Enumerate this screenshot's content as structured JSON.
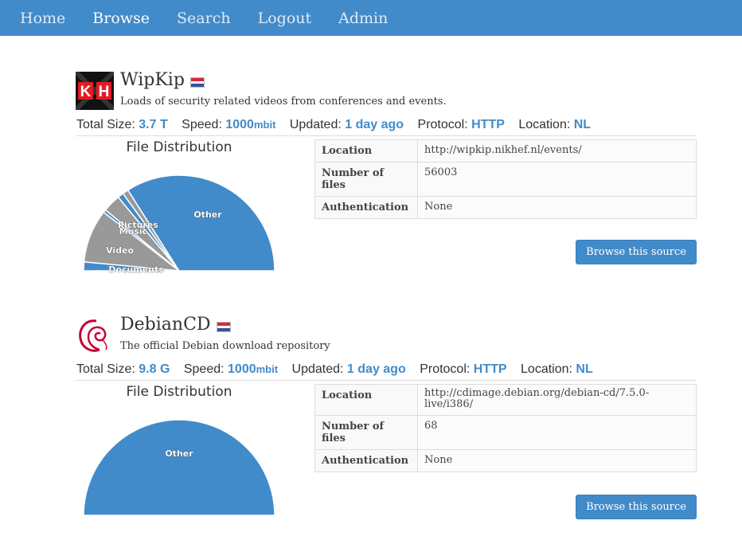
{
  "nav": {
    "items": [
      {
        "label": "Home"
      },
      {
        "label": "Browse",
        "active": true
      },
      {
        "label": "Search"
      },
      {
        "label": "Logout"
      },
      {
        "label": "Admin"
      }
    ]
  },
  "colors": {
    "accent": "#428bca",
    "gray": "#999999",
    "flag_red": "#d7283d",
    "flag_white": "#ffffff",
    "flag_blue": "#3751a5"
  },
  "sources": [
    {
      "name": "WipKip",
      "description": "Loads of security related videos from conferences and events.",
      "logo_icon": "kh-logo-icon",
      "flag_icon": "flag-nl-icon",
      "stats": {
        "size_label": "Total Size:",
        "size_value": "3.7 T",
        "speed_label": "Speed:",
        "speed_value": "1000",
        "speed_unit": "mbit",
        "updated_label": "Updated:",
        "updated_value": "1 day ago",
        "protocol_label": "Protocol:",
        "protocol_value": "HTTP",
        "location_label": "Location:",
        "location_value": "NL"
      },
      "chart_title": "File Distribution",
      "chart_data": {
        "type": "pie",
        "title": "File Distribution",
        "slices": [
          {
            "label": "Documents",
            "value": 3,
            "color": "#428bca"
          },
          {
            "label": "Video",
            "value": 18,
            "color": "#999999"
          },
          {
            "label": "Music",
            "value": 1,
            "color": "#428bca"
          },
          {
            "label": "Pictures",
            "value": 6,
            "color": "#999999"
          },
          {
            "label": "",
            "value": 2,
            "color": "#428bca"
          },
          {
            "label": "",
            "value": 2,
            "color": "#999999"
          },
          {
            "label": "Other",
            "value": 68,
            "color": "#428bca"
          }
        ]
      },
      "table": [
        {
          "key": "Location",
          "value": "http://wipkip.nikhef.nl/events/"
        },
        {
          "key": "Number of files",
          "value": "56003"
        },
        {
          "key": "Authentication",
          "value": "None"
        }
      ],
      "button_label": "Browse this source"
    },
    {
      "name": "DebianCD",
      "description": "The official Debian download repository",
      "logo_icon": "debian-swirl-icon",
      "flag_icon": "flag-nl-icon",
      "stats": {
        "size_label": "Total Size:",
        "size_value": "9.8 G",
        "speed_label": "Speed:",
        "speed_value": "1000",
        "speed_unit": "mbit",
        "updated_label": "Updated:",
        "updated_value": "1 day ago",
        "protocol_label": "Protocol:",
        "protocol_value": "HTTP",
        "location_label": "Location:",
        "location_value": "NL"
      },
      "chart_title": "File Distribution",
      "chart_data": {
        "type": "pie",
        "title": "File Distribution",
        "slices": [
          {
            "label": "Other",
            "value": 100,
            "color": "#428bca"
          }
        ]
      },
      "table": [
        {
          "key": "Location",
          "value": "http://cdimage.debian.org/debian-cd/7.5.0-live/i386/"
        },
        {
          "key": "Number of files",
          "value": "68"
        },
        {
          "key": "Authentication",
          "value": "None"
        }
      ],
      "button_label": "Browse this source"
    }
  ]
}
